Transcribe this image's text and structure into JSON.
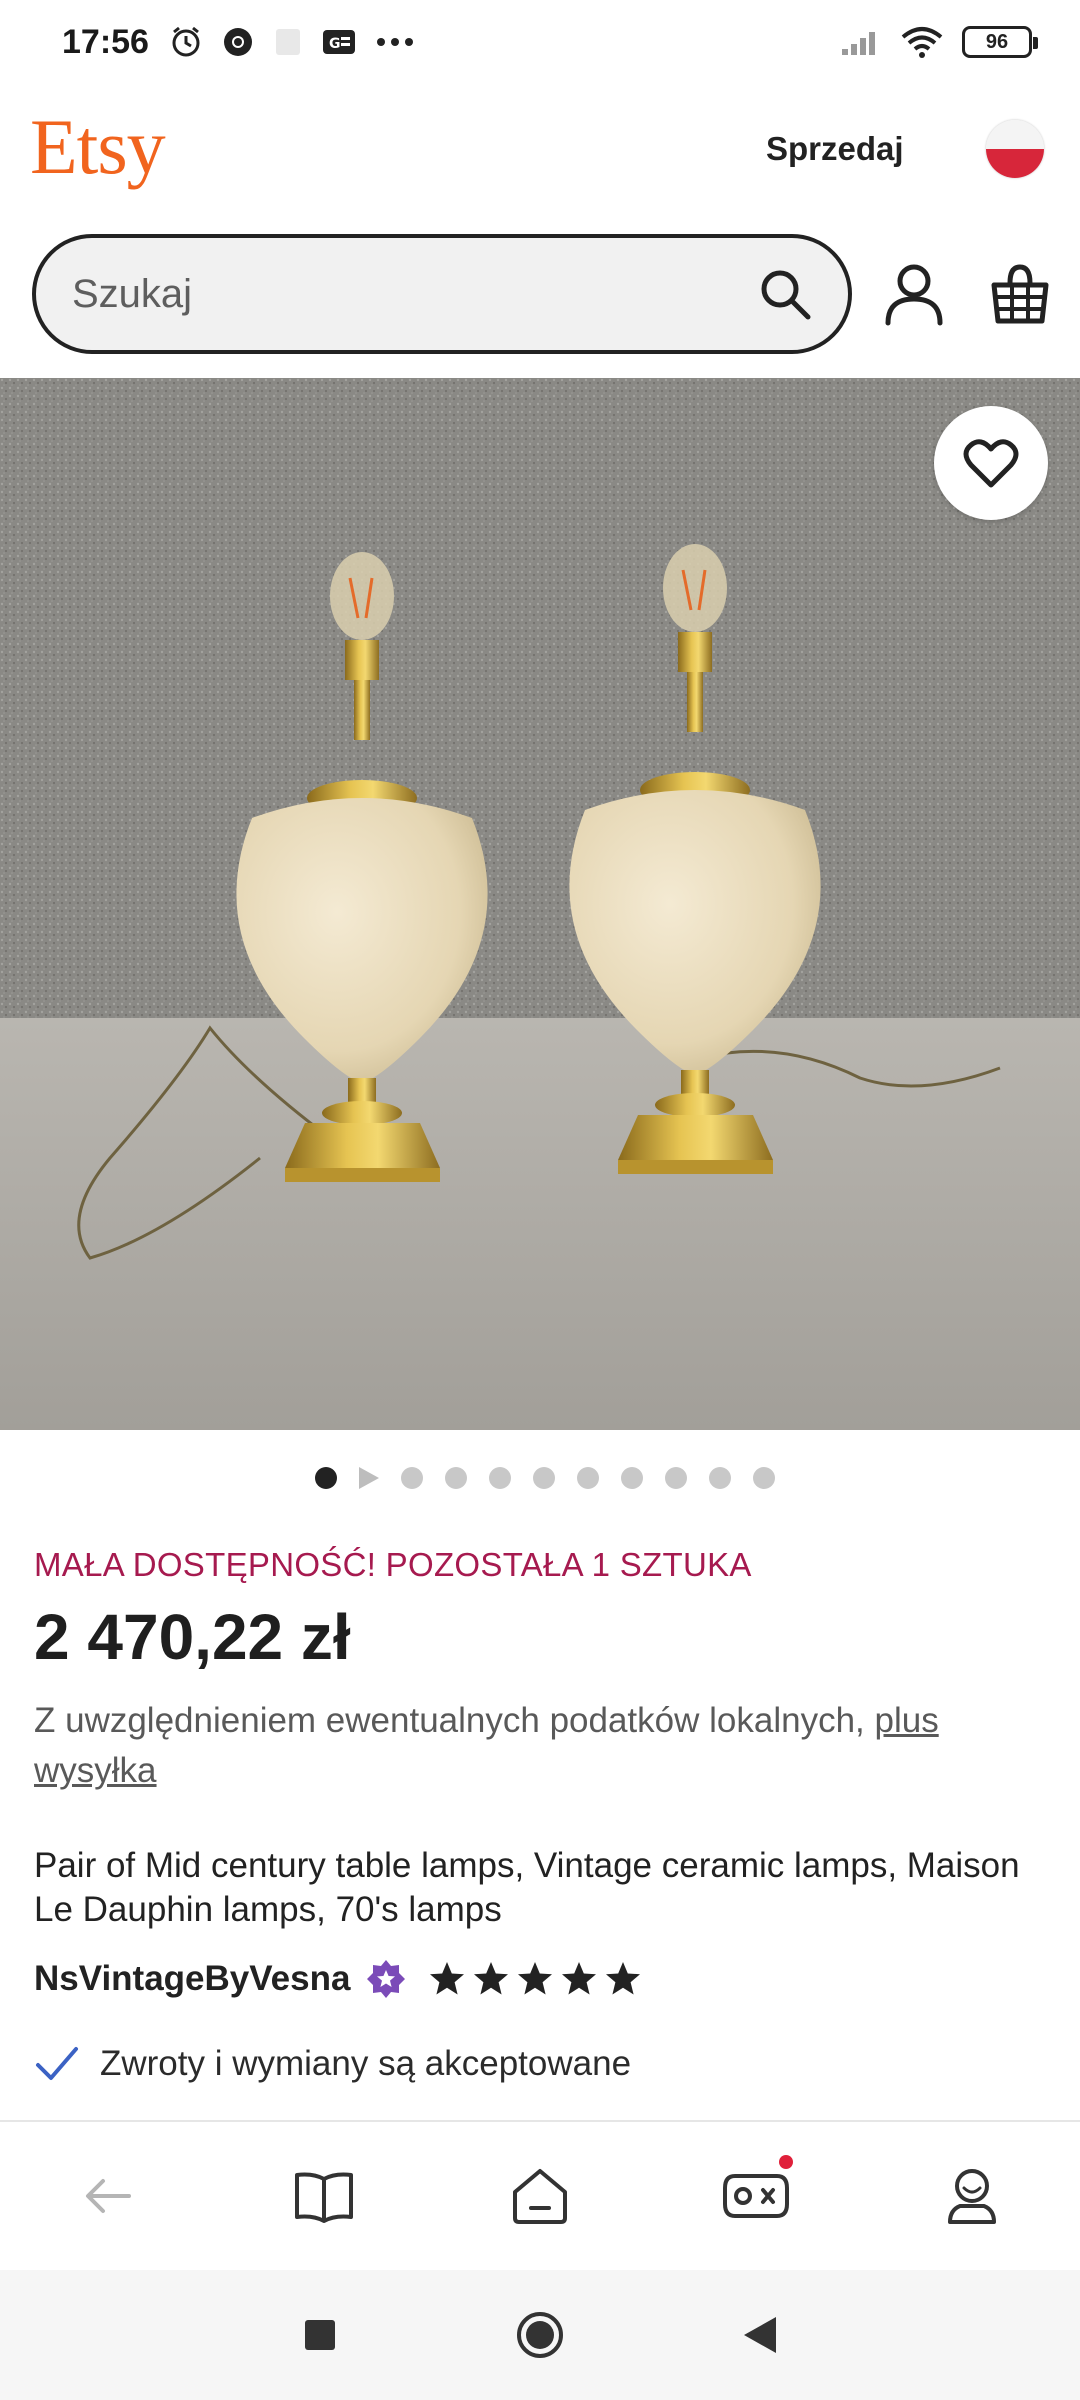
{
  "status_bar": {
    "time": "17:56",
    "battery": "96",
    "left_icons": [
      "alarm-icon",
      "chrome-icon",
      "notification-icon",
      "g-news-icon",
      "more-icon"
    ],
    "right_icons": [
      "signal-icon",
      "wifi-icon",
      "battery-icon"
    ]
  },
  "header": {
    "logo": "Etsy",
    "sell_label": "Sprzedaj",
    "flag": "poland-flag"
  },
  "search": {
    "placeholder": "Szukaj"
  },
  "gallery": {
    "total_dots": 11,
    "active_index": 0
  },
  "listing": {
    "availability": "MAŁA DOSTĘPNOŚĆ! POZOSTAŁA 1 SZTUKA",
    "price": "2 470,22 zł",
    "tax_note_prefix": "Z uwzględnieniem ewentualnych podatków lokalnych, ",
    "tax_note_link": "plus wysyłka",
    "title": "Pair of Mid century table lamps, Vintage ceramic lamps, Maison Le Dauphin lamps, 70's lamps",
    "shop_name": "NsVintageByVesna",
    "rating_stars": 5,
    "returns": "Zwroty i wymiany są akceptowane"
  },
  "colors": {
    "brand": "#F1641E",
    "availability": "#A61A4F",
    "text": "#222222"
  }
}
